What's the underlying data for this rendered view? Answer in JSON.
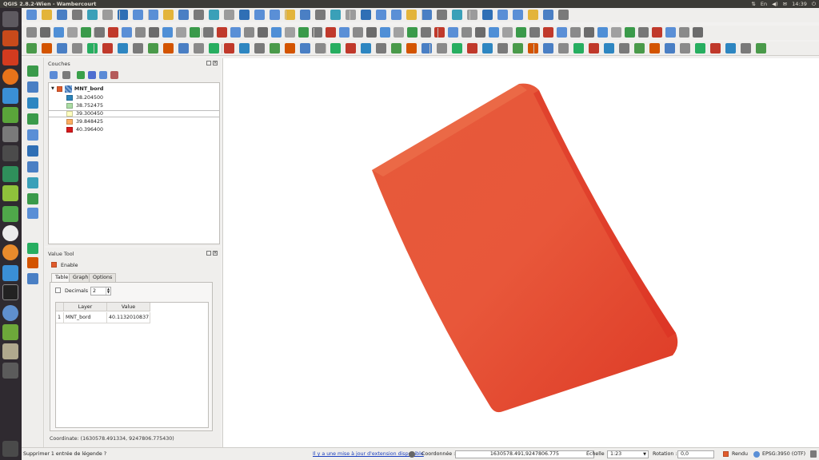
{
  "window": {
    "title": "QGIS 2.8.2-Wien - Wambercourt",
    "clock": "14:39",
    "tray": [
      "⇅",
      "En",
      "◀)",
      "✉",
      "⏻"
    ]
  },
  "layers_panel": {
    "title": "Couches",
    "layer_name": "MNT_bord",
    "legend": [
      {
        "label": "38.204500",
        "color": "#2b83ba"
      },
      {
        "label": "38.752475",
        "color": "#abdda4"
      },
      {
        "label": "39.300450",
        "color": "#ffffbf"
      },
      {
        "label": "39.848425",
        "color": "#fdae61"
      },
      {
        "label": "40.396400",
        "color": "#d7191c"
      }
    ]
  },
  "value_tool": {
    "title": "Value Tool",
    "enable_label": "Enable",
    "tabs": [
      "Table",
      "Graph",
      "Options"
    ],
    "decimals_label": "Decimals",
    "decimals_value": "2",
    "columns": [
      "Layer",
      "Value"
    ],
    "rows": [
      {
        "index": "1",
        "layer": "MNT_bord",
        "value": "40.1132010837"
      }
    ],
    "coordinate_text": "Coordinate: (1630578.491334, 9247806.775430)"
  },
  "statusbar": {
    "message": "Supprimer 1 entrée de légende ?",
    "update_link": "Il y a une mise à jour d'extension disponible",
    "coord_label": "Coordonnée :",
    "coord_value": "1630578.491,9247806.775",
    "scale_label": "Échelle",
    "scale_value": "1:23",
    "rotation_label": "Rotation :",
    "rotation_value": "0,0",
    "render_label": "Rendu",
    "crs": "EPSG:3950 (OTF)"
  },
  "colors": {
    "raster_main": "#e8503a",
    "raster_edge": "#d93324",
    "accent": "#e05b2c",
    "link": "#1a3fbf"
  }
}
